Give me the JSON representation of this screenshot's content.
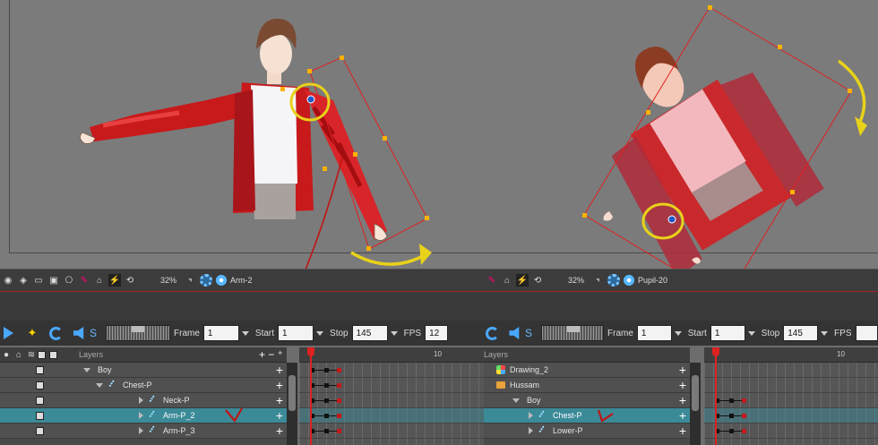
{
  "viewer_left": {
    "zoom": "32%",
    "node_name": "Arm-2"
  },
  "viewer_right": {
    "zoom": "32%",
    "node_name": "Pupil-20"
  },
  "playback_left": {
    "frame_label": "Frame",
    "frame_value": "1",
    "start_label": "Start",
    "start_value": "1",
    "stop_label": "Stop",
    "stop_value": "145",
    "fps_label": "FPS",
    "fps_value": "12"
  },
  "playback_right": {
    "frame_label": "Frame",
    "frame_value": "1",
    "start_label": "Start",
    "start_value": "1",
    "stop_label": "Stop",
    "stop_value": "145",
    "fps_label": "FPS"
  },
  "layers_left": {
    "header": "Layers",
    "rows": [
      {
        "label": "Boy"
      },
      {
        "label": "Chest-P"
      },
      {
        "label": "Neck-P"
      },
      {
        "label": "Arm-P_2"
      },
      {
        "label": "Arm-P_3"
      }
    ]
  },
  "layers_right": {
    "header": "Layers",
    "rows": [
      {
        "label": "Drawing_2"
      },
      {
        "label": "Hussam"
      },
      {
        "label": "Boy"
      },
      {
        "label": "Chest-P"
      },
      {
        "label": "Lower-P"
      }
    ]
  },
  "timeline_left": {
    "tick_label": "10"
  },
  "timeline_right": {
    "tick_label": "10"
  },
  "colors": {
    "selection": "#3b8a98",
    "annotation_yellow": "#e8d21a",
    "annotation_red": "#c01414",
    "bounding_box": "#e02020"
  }
}
